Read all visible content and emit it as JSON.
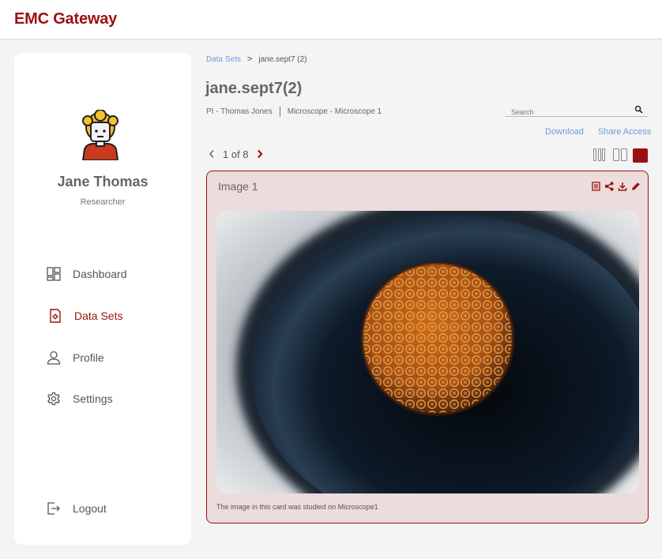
{
  "app": {
    "brand": "EMC Gateway"
  },
  "user": {
    "name": "Jane Thomas",
    "role": "Researcher"
  },
  "sidebar": {
    "items": [
      {
        "label": "Dashboard",
        "icon": "dashboard-icon"
      },
      {
        "label": "Data Sets",
        "icon": "data-sets-icon",
        "active": true
      },
      {
        "label": "Profile",
        "icon": "profile-icon"
      },
      {
        "label": "Settings",
        "icon": "gear-icon"
      }
    ],
    "logout_label": "Logout"
  },
  "breadcrumb": {
    "parent": "Data Sets",
    "separator": ">",
    "current": "jane.sept7 (2)"
  },
  "dataset": {
    "title": "jane.sept7(2)",
    "pi": "PI - Thomas Jones",
    "microscope": "Microscope - Microscope 1"
  },
  "search": {
    "placeholder": "Search"
  },
  "actions": {
    "download": "Download",
    "share": "Share Access"
  },
  "pager": {
    "text": "1 of 8",
    "current": 1,
    "total": 8
  },
  "card": {
    "title": "Image 1",
    "caption": "The image in this card was studied on Microscope1"
  },
  "colors": {
    "brand": "#9b1111",
    "link": "#6c9bd8",
    "card_bg": "#ecdcdc"
  }
}
